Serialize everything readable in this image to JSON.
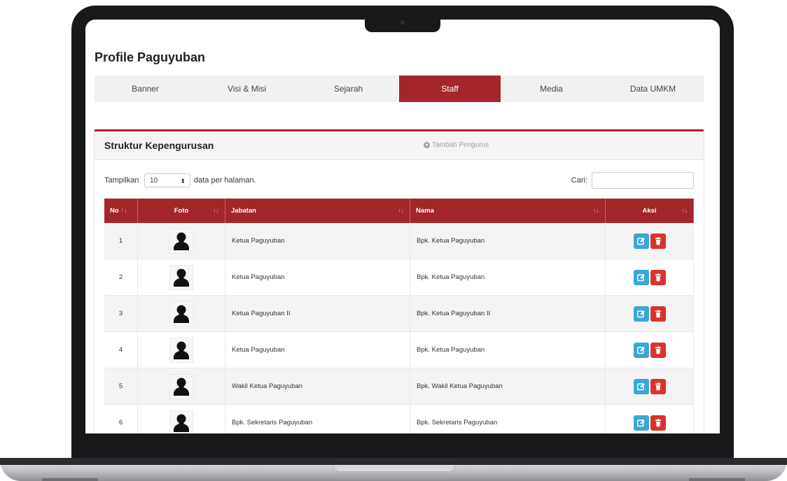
{
  "page": {
    "title": "Profile Paguyuban"
  },
  "tabs": [
    {
      "label": "Banner",
      "active": false
    },
    {
      "label": "Visi & Misi",
      "active": false
    },
    {
      "label": "Sejarah",
      "active": false
    },
    {
      "label": "Staff",
      "active": true
    },
    {
      "label": "Media",
      "active": false
    },
    {
      "label": "Data UMKM",
      "active": false
    }
  ],
  "panel": {
    "title": "Struktur Kepengurusan",
    "add_label": "Tambah Pengurus"
  },
  "controls": {
    "show_label": "Tampilkan",
    "page_length": "10",
    "per_page_label": "data per halaman.",
    "search_label": "Cari:",
    "search_value": ""
  },
  "table": {
    "columns": [
      "No",
      "Foto",
      "Jabatan",
      "Nama",
      "Aksi"
    ],
    "rows": [
      {
        "no": "1",
        "jabatan": "Ketua Paguyuban",
        "nama": "Bpk. Ketua Paguyuban"
      },
      {
        "no": "2",
        "jabatan": "Ketua Paguyuban",
        "nama": "Bpk. Ketua Paguyuban"
      },
      {
        "no": "3",
        "jabatan": "Ketua Paguyuban II",
        "nama": "Bpk. Ketua Paguyuban II"
      },
      {
        "no": "4",
        "jabatan": "Ketua Paguyuban",
        "nama": "Bpk. Ketua Paguyuban"
      },
      {
        "no": "5",
        "jabatan": "Wakil Ketua Paguyuban",
        "nama": "Bpk. Wakil Ketua Paguyuban"
      },
      {
        "no": "6",
        "jabatan": "Bpk. Sekretaris Paguyuban",
        "nama": "Bpk. Sekretaris Paguyuban"
      }
    ]
  },
  "icons": {
    "photo": "user-silhouette-icon",
    "edit": "edit-icon",
    "delete": "trash-icon",
    "add": "plus-circle-icon",
    "sort": "sort-arrows-icon"
  },
  "colors": {
    "accent": "#a3262b",
    "edit": "#3aa7d7",
    "delete": "#d9342b"
  }
}
